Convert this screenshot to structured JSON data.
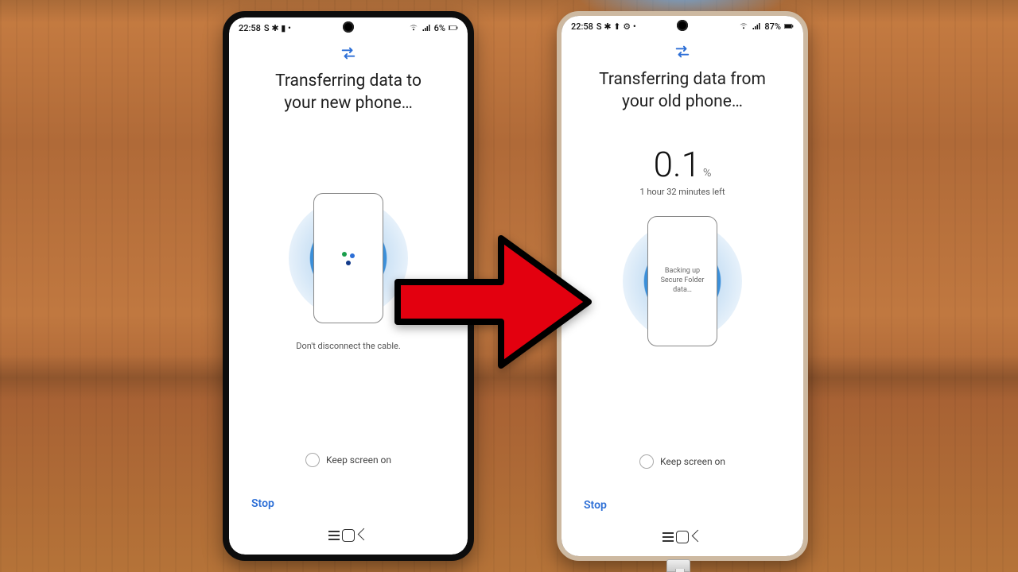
{
  "left": {
    "status": {
      "time": "22:58",
      "left_icons": "S ✱ ▮ •",
      "signal_label": "Wi-Fi / signal",
      "battery": "6%"
    },
    "title": "Transferring data to\nyour new phone…",
    "caption": "Don't disconnect the cable.",
    "keep_screen_label": "Keep screen on",
    "stop_label": "Stop"
  },
  "right": {
    "status": {
      "time": "22:58",
      "left_icons": "S ✱ ⬆ ⚙ •",
      "signal_label": "Wi-Fi / signal",
      "battery": "87%"
    },
    "title": "Transferring data from\nyour old phone…",
    "percent_value": "0.1",
    "percent_symbol": "%",
    "time_left": "1 hour 32 minutes left",
    "mini_phone_text": "Backing up\nSecure Folder\ndata…",
    "keep_screen_label": "Keep screen on",
    "stop_label": "Stop"
  },
  "icons": {
    "swap_name": "swap-icon"
  }
}
